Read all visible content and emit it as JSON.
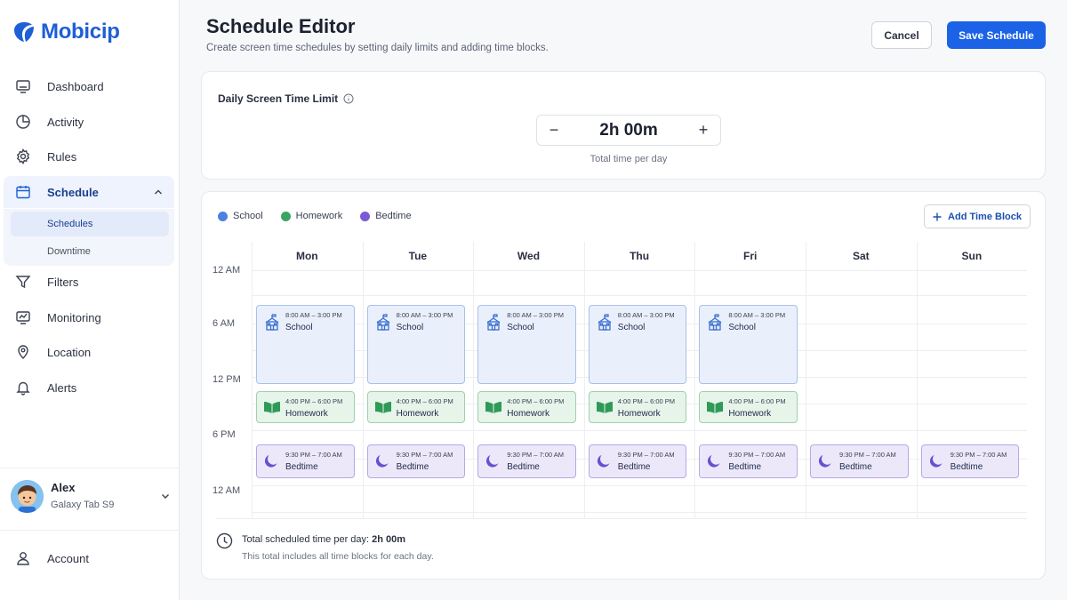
{
  "app": {
    "name": "Mobicip"
  },
  "sidebar": {
    "items": [
      {
        "label": "Dashboard",
        "icon": "monitor-icon"
      },
      {
        "label": "Activity",
        "icon": "clock-pie-icon"
      },
      {
        "label": "Rules",
        "icon": "gear-icon"
      },
      {
        "label": "Schedule",
        "icon": "calendar-icon"
      },
      {
        "label": "Filters",
        "icon": "filter-icon"
      },
      {
        "label": "Monitoring",
        "icon": "chart-monitor-icon"
      },
      {
        "label": "Location",
        "icon": "location-pin-icon"
      },
      {
        "label": "Alerts",
        "icon": "bell-icon"
      }
    ],
    "schedule_sub": [
      {
        "label": "Schedules"
      },
      {
        "label": "Downtime"
      }
    ],
    "profile": {
      "name": "Alex",
      "device": "Galaxy Tab S9"
    },
    "account": {
      "label": "Account"
    }
  },
  "header": {
    "title": "Schedule Editor",
    "subtitle": "Create screen time schedules by setting daily limits and adding time blocks.",
    "cancel_label": "Cancel",
    "save_label": "Save Schedule"
  },
  "limit": {
    "title": "Daily Screen Time Limit",
    "value": "2h 00m",
    "caption": "Total time per day",
    "minus": "−",
    "plus": "+"
  },
  "legend": [
    {
      "label": "School",
      "color": "#4a82e0"
    },
    {
      "label": "Homework",
      "color": "#3aa563"
    },
    {
      "label": "Bedtime",
      "color": "#7a5bd6"
    }
  ],
  "add_block_label": "Add Time Block",
  "days": [
    "Mon",
    "Tue",
    "Wed",
    "Thu",
    "Fri",
    "Sat",
    "Sun"
  ],
  "time_labels": [
    "12 AM",
    "6 AM",
    "12 PM",
    "6 PM",
    "12 AM"
  ],
  "blocks": {
    "school": {
      "time": "8:00 AM – 3:00 PM",
      "name": "School"
    },
    "homework": {
      "time": "4:00 PM – 6:00 PM",
      "name": "Homework"
    },
    "bedtime": {
      "time": "9:30 PM – 7:00 AM",
      "name": "Bedtime"
    }
  },
  "summary": {
    "label": "Total scheduled time per day:",
    "value": "2h 00m",
    "note": "This total includes all time blocks for each day."
  }
}
